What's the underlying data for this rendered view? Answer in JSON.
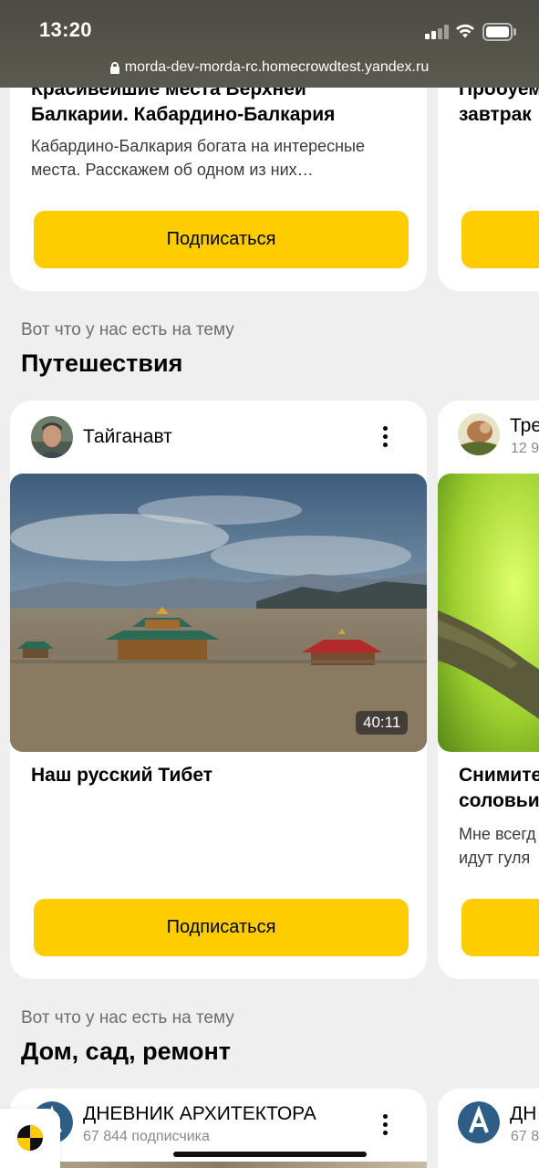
{
  "status_bar": {
    "time": "13:20"
  },
  "browser": {
    "url": "morda-dev-morda-rc.homecrowdtest.yandex.ru"
  },
  "feed": {
    "top_cards": [
      {
        "title_lines": [
          "Красивейшие места Верхней",
          "Балкарии. Кабардино-Балкария"
        ],
        "description_lines": [
          "Кабардино-Балкария богата на интересные",
          "места. Расскажем об одном из них…"
        ],
        "button": "Подписаться"
      },
      {
        "title_lines": [
          "Пробуем",
          "завтрак"
        ]
      }
    ],
    "sections": [
      {
        "caption": "Вот что у нас есть на тему",
        "heading": "Путешествия",
        "cards": [
          {
            "channel": "Тайганавт",
            "duration": "40:11",
            "title": "Наш русский Тибет",
            "button": "Подписаться"
          },
          {
            "channel": "Тре",
            "subscribers": "12 9",
            "title_lines": [
              "Снимите",
              "соловьи"
            ],
            "description_lines": [
              "Мне всегд",
              "идут гуля"
            ]
          }
        ]
      },
      {
        "caption": "Вот что у нас есть на тему",
        "heading": "Дом, сад, ремонт",
        "cards": [
          {
            "channel": "ДНЕВНИК АРХИТЕКТОРА",
            "subscribers": "67 844 подписчика"
          },
          {
            "channel": "ДН",
            "subscribers": "67 8"
          }
        ]
      }
    ]
  },
  "colors": {
    "accent": "#ffcc00",
    "background": "#efefef",
    "card": "#ffffff"
  },
  "icons": [
    "lock-icon",
    "signal-icon",
    "wifi-icon",
    "battery-icon",
    "more-dots-icon",
    "yandex-fab-icon"
  ]
}
